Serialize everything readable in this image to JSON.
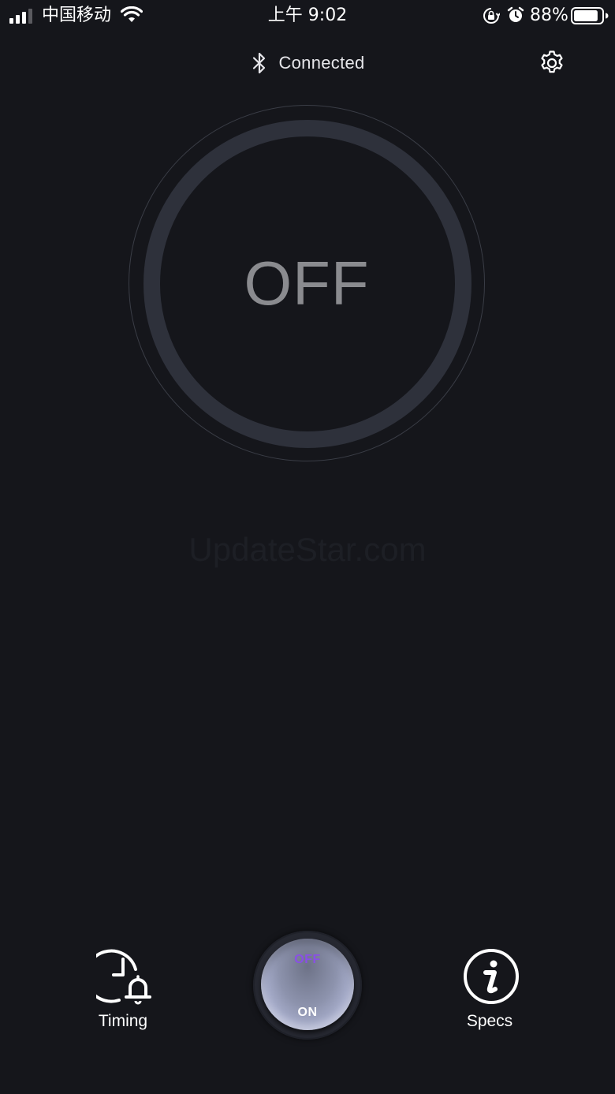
{
  "status_bar": {
    "carrier": "中国移动",
    "time": "上午 9:02",
    "battery_percent": "88%",
    "battery_level": 0.88,
    "icons": [
      "signal-icon",
      "wifi-icon",
      "orientation-lock-icon",
      "alarm-icon",
      "battery-icon"
    ]
  },
  "header": {
    "connection_status": "Connected",
    "bluetooth_icon": "bluetooth-icon",
    "settings_icon": "gear-icon"
  },
  "dial": {
    "state": "OFF"
  },
  "watermark": "UpdateStar.com",
  "bottom_bar": {
    "timing": {
      "label": "Timing",
      "icon": "clock-alarm-icon"
    },
    "power_toggle": {
      "off_label": "OFF",
      "on_label": "ON",
      "accent": "#8a4fe6"
    },
    "specs": {
      "label": "Specs",
      "icon": "info-icon"
    }
  },
  "colors": {
    "background": "#15161b",
    "ring": "#2e313b",
    "state_text": "#8a8b8f"
  }
}
